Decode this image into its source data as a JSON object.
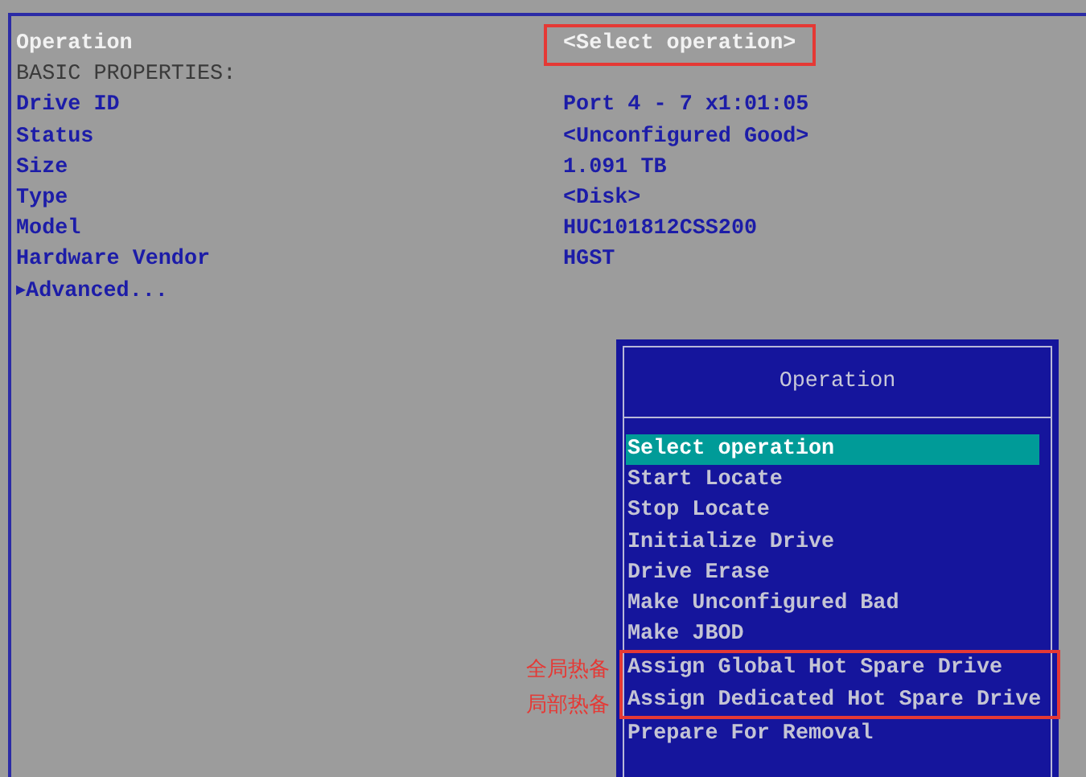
{
  "header": {
    "label": "Operation",
    "value": "<Select operation>",
    "value_highlighted": true
  },
  "section_title": "BASIC PROPERTIES:",
  "properties": [
    {
      "label": "Drive ID",
      "value": "Port 4 - 7 x1:01:05"
    },
    {
      "label": "Status",
      "value": "<Unconfigured Good>"
    },
    {
      "label": "Size",
      "value": "1.091 TB"
    },
    {
      "label": "Type",
      "value": "<Disk>"
    },
    {
      "label": "Model",
      "value": "HUC101812CSS200"
    },
    {
      "label": "Hardware Vendor",
      "value": "HGST"
    }
  ],
  "advanced": {
    "arrow": "▶",
    "label": "Advanced..."
  },
  "popup": {
    "title": "Operation",
    "items": [
      {
        "label": "Select operation",
        "selected": true,
        "highlighted": false
      },
      {
        "label": "Start Locate",
        "selected": false,
        "highlighted": false
      },
      {
        "label": "Stop Locate",
        "selected": false,
        "highlighted": false
      },
      {
        "label": "Initialize Drive",
        "selected": false,
        "highlighted": false
      },
      {
        "label": "Drive Erase",
        "selected": false,
        "highlighted": false
      },
      {
        "label": "Make Unconfigured Bad",
        "selected": false,
        "highlighted": false
      },
      {
        "label": "Make JBOD",
        "selected": false,
        "highlighted": false
      },
      {
        "label": "Assign Global Hot Spare Drive",
        "selected": false,
        "highlighted": true
      },
      {
        "label": "Assign Dedicated Hot Spare Drive",
        "selected": false,
        "highlighted": true
      },
      {
        "label": "Prepare For Removal",
        "selected": false,
        "highlighted": false
      }
    ]
  },
  "annotation_notes": [
    "全局热备",
    "局部热备"
  ]
}
